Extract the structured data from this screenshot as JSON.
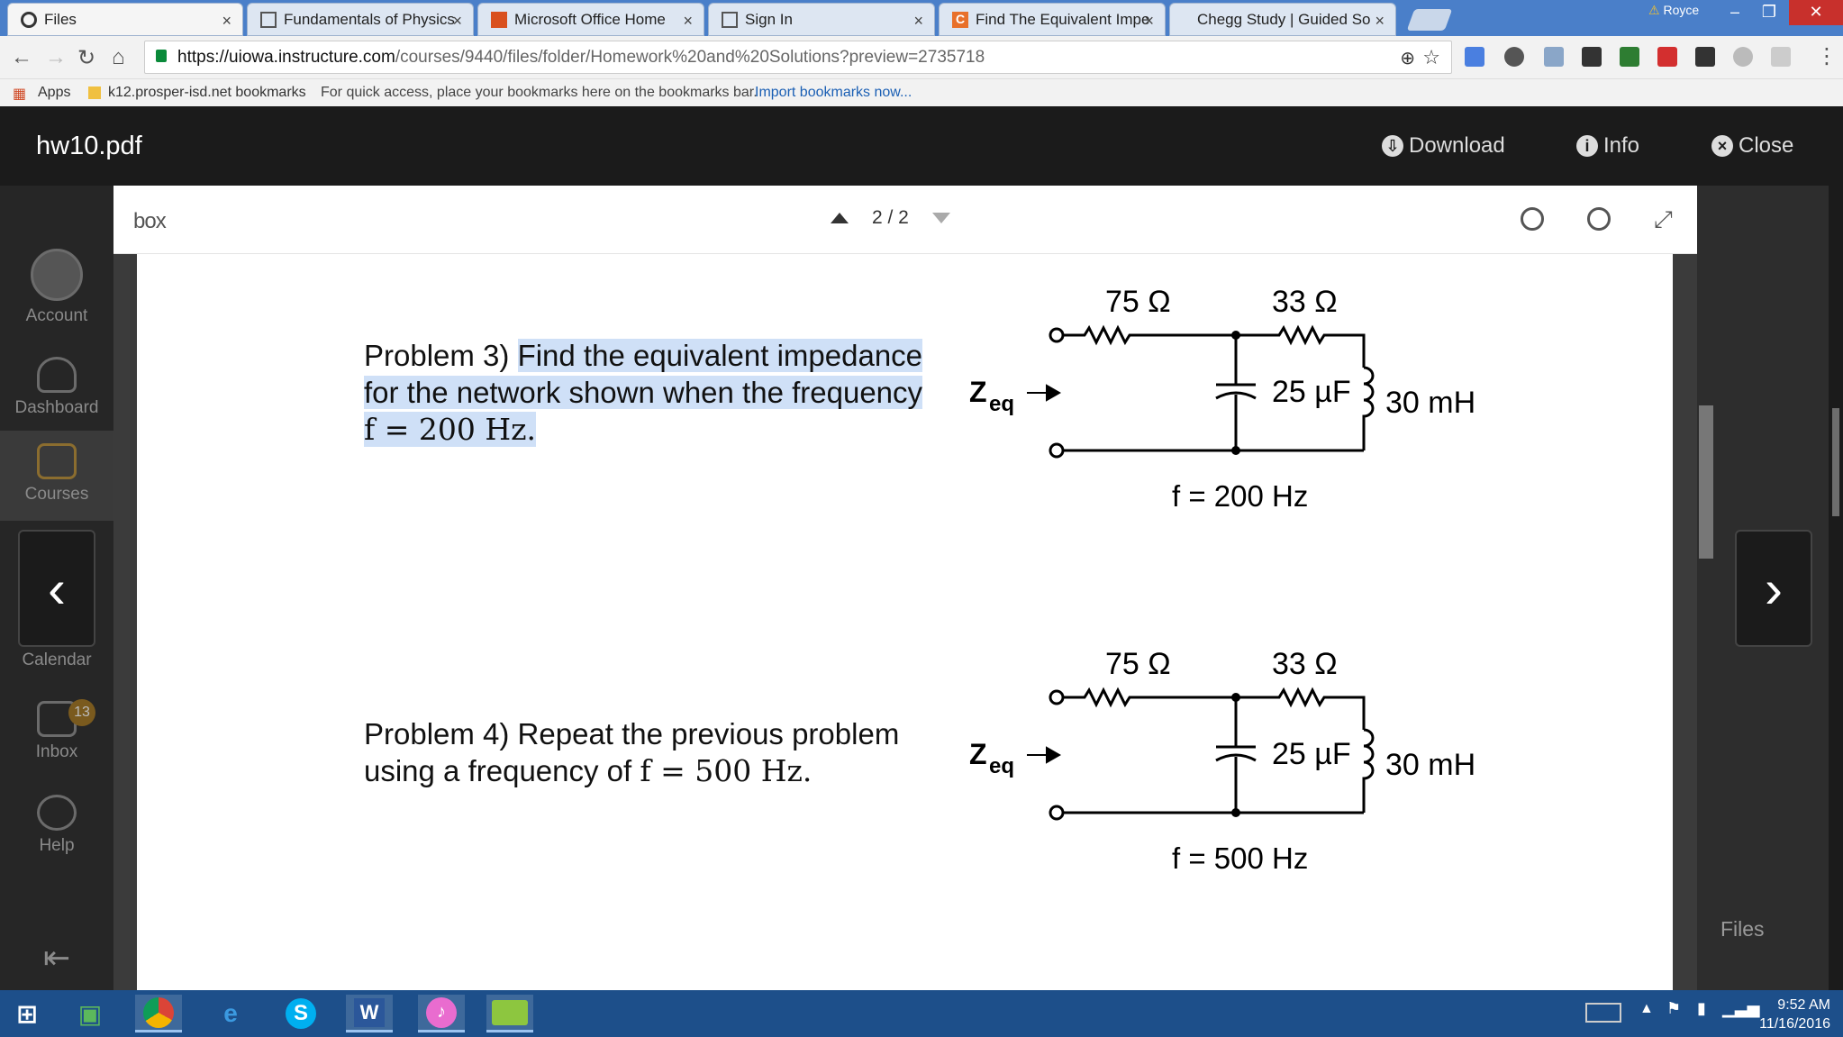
{
  "browser": {
    "tabs": [
      {
        "label": "Files",
        "active": true
      },
      {
        "label": "Fundamentals of Physics",
        "active": false
      },
      {
        "label": "Microsoft Office Home",
        "active": false
      },
      {
        "label": "Sign In",
        "active": false
      },
      {
        "label": "Find The Equivalent Impe",
        "active": false
      },
      {
        "label": "Chegg Study | Guided So",
        "active": false
      }
    ],
    "profile_name": "Royce",
    "url_host": "https://uiowa.instructure.com",
    "url_path": "/courses/9440/files/folder/Homework%20and%20Solutions?preview=2735718",
    "bookmarks": {
      "apps": "Apps",
      "folder": "k12.prosper-isd.net bookmarks",
      "hint": "For quick access, place your bookmarks here on the bookmarks bar.",
      "import_link": "Import bookmarks now..."
    }
  },
  "viewer": {
    "title": "hw10.pdf",
    "download": "Download",
    "info": "Info",
    "close": "Close",
    "box_logo": "box",
    "page_indicator": "2 / 2",
    "files_link": "Files"
  },
  "sidebar": {
    "items": [
      {
        "label": "Account"
      },
      {
        "label": "Dashboard"
      },
      {
        "label": "Courses"
      },
      {
        "label": "Calendar"
      },
      {
        "label": "Inbox",
        "badge": "13"
      },
      {
        "label": "Help"
      }
    ]
  },
  "problems": [
    {
      "text_plain": "Problem 3) ",
      "text_highlight_line1": "Find the equivalent impedance",
      "text_highlight_line2": "for the network shown when the frequency",
      "math": "f = 200 Hz.",
      "circuit": {
        "r1": "75 Ω",
        "r2": "33 Ω",
        "cap": "25 µF",
        "ind": "30 mH",
        "zeq": "Z",
        "zeq_sub": "eq",
        "freq": "f = 200 Hz"
      }
    },
    {
      "text_line1": "Problem 4) Repeat the previous problem",
      "text_line2": "using a frequency of ",
      "math": "f = 500 Hz.",
      "circuit": {
        "r1": "75 Ω",
        "r2": "33 Ω",
        "cap": "25 µF",
        "ind": "30 mH",
        "zeq": "Z",
        "zeq_sub": "eq",
        "freq": "f = 500 Hz"
      }
    }
  ],
  "taskbar": {
    "time": "9:52 AM",
    "date": "11/16/2016",
    "apps": [
      "windows-start",
      "store",
      "chrome",
      "internet-explorer",
      "skype",
      "word",
      "itunes",
      "keyboard-app"
    ]
  },
  "colors": {
    "highlight": "#cfe0f7",
    "tabbar": "#4a7fc9",
    "taskbar": "#1d4f8a",
    "viewer_dark": "#1b1b1b"
  }
}
